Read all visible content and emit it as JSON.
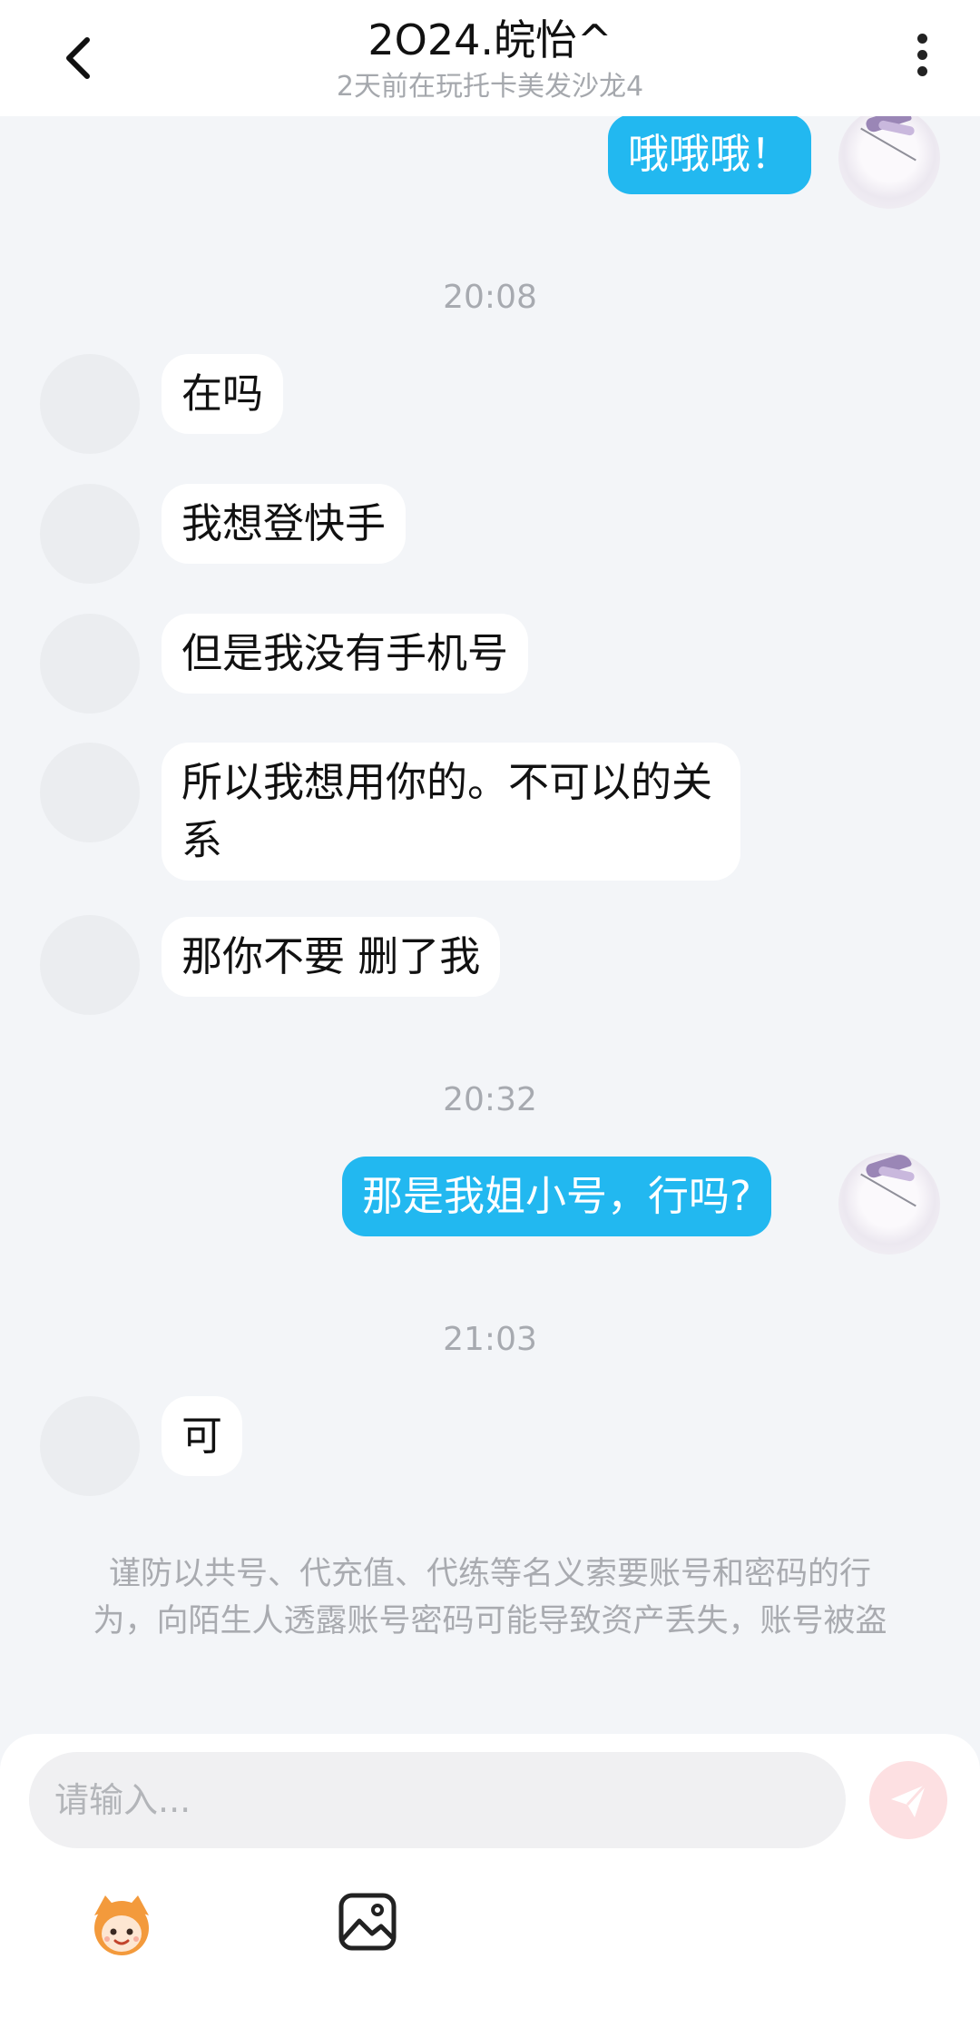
{
  "header": {
    "title": "2O24.皖怡^",
    "subtitle": "2天前在玩托卡美发沙龙4"
  },
  "messages": {
    "m0": "哦哦哦！",
    "t1": "20:08",
    "m1": "在吗",
    "m2": "我想登快手",
    "m3": "但是我没有手机号",
    "m4": "所以我想用你的。不可以的关系",
    "m5": "那你不要 删了我",
    "t2": "20:32",
    "m6": "那是我姐小号，行吗?",
    "t3": "21:03",
    "m7": "可"
  },
  "warning": "谨防以共号、代充值、代练等名义索要账号和密码的行为，向陌生人透露账号密码可能导致资产丢失，账号被盗",
  "composer": {
    "placeholder": "请输入..."
  },
  "colors": {
    "accent": "#22b8f0",
    "send_disabled": "#fde0e2",
    "background": "#f3f5f8"
  },
  "icons": [
    "back-icon",
    "more-icon",
    "send-icon",
    "emoji-icon",
    "image-icon"
  ]
}
